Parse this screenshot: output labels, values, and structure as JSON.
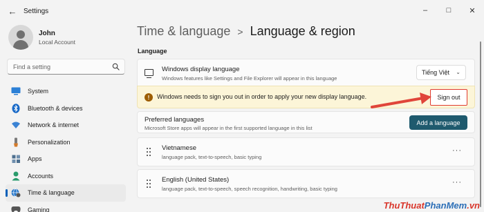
{
  "window": {
    "title": "Settings",
    "controls": [
      "–",
      "□",
      "✕"
    ]
  },
  "profile": {
    "name": "John",
    "account": "Local Account"
  },
  "search": {
    "placeholder": "Find a setting"
  },
  "sidebar": {
    "items": [
      {
        "label": "System",
        "icon": "monitor-icon",
        "color": "#2b7fd6"
      },
      {
        "label": "Bluetooth & devices",
        "icon": "bluetooth-icon",
        "color": "#1668c7"
      },
      {
        "label": "Network & internet",
        "icon": "wifi-icon",
        "color": "#3b83d4"
      },
      {
        "label": "Personalization",
        "icon": "brush-icon",
        "color": "#d47b2b"
      },
      {
        "label": "Apps",
        "icon": "apps-icon",
        "color": "#4d6f8f"
      },
      {
        "label": "Accounts",
        "icon": "person-icon",
        "color": "#2a9b6c"
      },
      {
        "label": "Time & language",
        "icon": "globe-clock-icon",
        "color": "#2676c9",
        "active": true
      },
      {
        "label": "Gaming",
        "icon": "gamepad-icon",
        "color": "#555555"
      }
    ]
  },
  "breadcrumb": {
    "parent": "Time & language",
    "separator": ">",
    "current": "Language & region"
  },
  "section": {
    "title": "Language"
  },
  "display_language": {
    "title": "Windows display language",
    "subtitle": "Windows features like Settings and File Explorer will appear in this language",
    "selected": "Tiếng Việt"
  },
  "warning": {
    "text": "Windows needs to sign you out in order to apply your new display language.",
    "button": "Sign out"
  },
  "preferred": {
    "title": "Preferred languages",
    "subtitle": "Microsoft Store apps will appear in the first supported language in this list",
    "button": "Add a language"
  },
  "languages": [
    {
      "name": "Vietnamese",
      "features": "language pack, text-to-speech, basic typing"
    },
    {
      "name": "English (United States)",
      "features": "language pack, text-to-speech, speech recognition, handwriting, basic typing"
    }
  ],
  "watermark": {
    "part1": "ThuThuat",
    "part2": "PhanMem",
    "part3": ".vn"
  },
  "colors": {
    "accent": "#005fb8",
    "add_button": "#1f5a6e",
    "warning_bg": "#fcf5d8",
    "highlight_border": "#e03a2f",
    "arrow": "#e0453a"
  }
}
